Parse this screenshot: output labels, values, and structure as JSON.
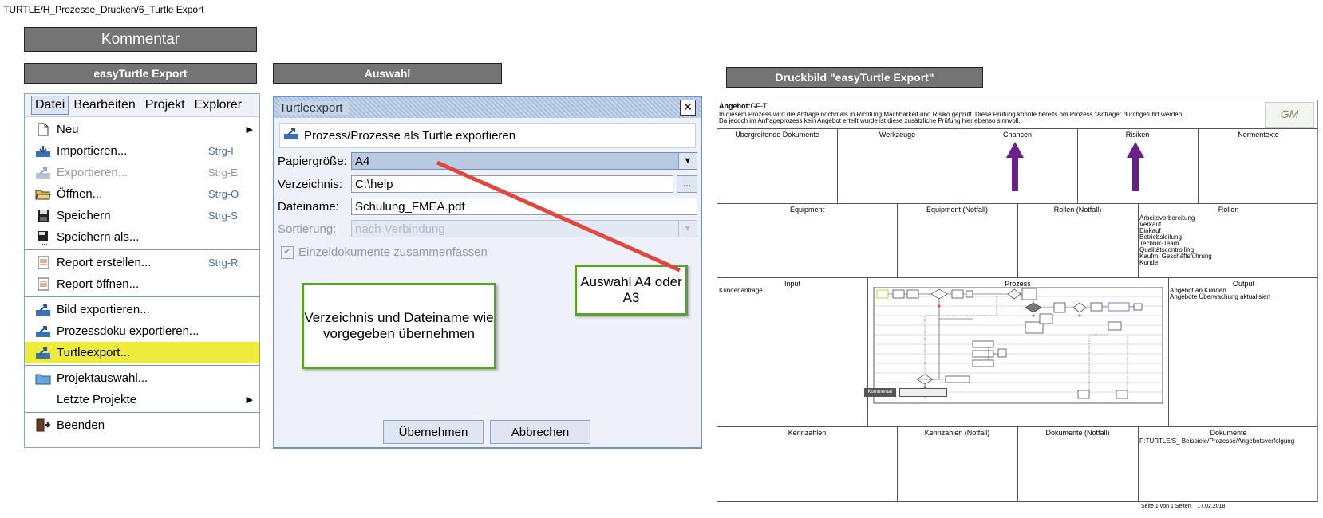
{
  "breadcrumb": "TURTLE/H_Prozesse_Drucken/6_Turtle Export",
  "headers": {
    "kommentar": "Kommentar",
    "export": "easyTurtle Export",
    "auswahl": "Auswahl",
    "druckbild": "Druckbild \"easyTurtle Export\""
  },
  "menubar": [
    "Datei",
    "Bearbeiten",
    "Projekt",
    "Explorer"
  ],
  "menu_items": [
    {
      "label": "Neu",
      "shortcut": "",
      "icon": "new-document-icon"
    },
    {
      "label": "Importieren...",
      "shortcut": "Strg-I",
      "icon": "import-icon"
    },
    {
      "label": "Exportieren...",
      "shortcut": "Strg-E",
      "icon": "export-icon"
    },
    {
      "label": "Öffnen...",
      "shortcut": "Strg-O",
      "icon": "folder-open-icon"
    },
    {
      "label": "Speichern",
      "shortcut": "Strg-S",
      "icon": "floppy-icon"
    },
    {
      "label": "Speichern als...",
      "shortcut": "",
      "icon": "floppy-as-icon"
    },
    {
      "label": "Report erstellen...",
      "shortcut": "Strg-R",
      "icon": "report-icon"
    },
    {
      "label": "Report öffnen...",
      "shortcut": "",
      "icon": "report-open-icon"
    },
    {
      "label": "Bild exportieren...",
      "shortcut": "",
      "icon": "export-image-icon"
    },
    {
      "label": "Prozessdoku exportieren...",
      "shortcut": "",
      "icon": "export-doc-icon"
    },
    {
      "label": "Turtleexport...",
      "shortcut": "",
      "icon": "turtle-export-icon"
    },
    {
      "label": "Projektauswahl...",
      "shortcut": "",
      "icon": "project-folder-icon"
    },
    {
      "label": "Letzte Projekte",
      "shortcut": "",
      "icon": ""
    },
    {
      "label": "Beenden",
      "shortcut": "",
      "icon": "exit-icon"
    }
  ],
  "dialog": {
    "title": "Turtleexport",
    "subtitle": "Prozess/Prozesse als Turtle exportieren",
    "paper_label": "Papiergröße:",
    "paper_value": "A4",
    "dir_label": "Verzeichnis:",
    "dir_value": "C:\\help",
    "browse": "...",
    "file_label": "Dateiname:",
    "file_value": "Schulung_FMEA.pdf",
    "sort_label": "Sortierung:",
    "sort_value": "nach Verbindung",
    "merge_label": "Einzeldokumente zusammenfassen",
    "ok": "Übernehmen",
    "cancel": "Abbrechen"
  },
  "notes": {
    "dir": "Verzeichnis und Dateiname wie vorgegeben übernehmen",
    "paper": "Auswahl A4 oder A3"
  },
  "preview": {
    "angebot_label": "Angebot:",
    "angebot_value": "GF-T",
    "desc1": "In diesem Prozess wird die Anfrage nochmals in Richtung Machbarkeit und Risiko geprüft. Diese Prüfung könnte bereits om Prozess \"Anfrage\" durchgeführt werden.",
    "desc2": "Da jedoch im Anfrageprozess kein Angebot erteilt wurde ist diese zusätzliche Prüfung hier ebenso sinnvoll.",
    "row1": [
      "Übergreifende Dokumente",
      "Werkzeuge",
      "Chancen",
      "Risiken",
      "Normentexte"
    ],
    "row2": [
      "Equipment",
      "Equipment (Notfall)",
      "Rollen (Notfall)",
      "Rollen"
    ],
    "rollen": [
      "Arbeitsvorbereitung",
      "Verkauf",
      "Einkauf",
      "Betriebsleitung",
      "Technik-Team",
      "Qualitätscontrolling",
      "Kaufm. Geschäftsführung",
      "Kunde"
    ],
    "row3": [
      "Input",
      "Prozess",
      "Output"
    ],
    "input": "Kundenanfrage",
    "output": [
      "Angebot an Kunden",
      "Angebote Überwachung aktualisiert"
    ],
    "row4": [
      "Kennzahlen",
      "Kennzahlen (Notfall)",
      "Dokumente (Notfall)",
      "Dokumente"
    ],
    "dokumente": "P:TURTLE/S_ Beispiele/Prozesse/Angebotsverfolgung",
    "kommentar_btn": "Kommentar",
    "footer": "Seite 1 von 1 Seiten    17.02.2018"
  },
  "colors": {
    "highlight": "#eeeb3c",
    "note_border": "#5aa02c",
    "arrow_red": "#e0473e",
    "arrow_purple": "#6a1f8a",
    "header_bg": "#747474"
  }
}
